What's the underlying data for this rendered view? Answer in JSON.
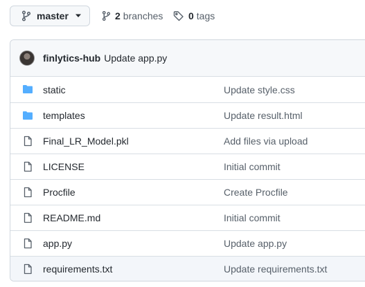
{
  "toolbar": {
    "branch_name": "master",
    "branches_count": "2",
    "branches_label": "branches",
    "tags_count": "0",
    "tags_label": "tags"
  },
  "commit": {
    "author": "finlytics-hub",
    "message": "Update app.py"
  },
  "files": [
    {
      "type": "folder",
      "name": "static",
      "commit": "Update style.css"
    },
    {
      "type": "folder",
      "name": "templates",
      "commit": "Update result.html"
    },
    {
      "type": "file",
      "name": "Final_LR_Model.pkl",
      "commit": "Add files via upload"
    },
    {
      "type": "file",
      "name": "LICENSE",
      "commit": "Initial commit"
    },
    {
      "type": "file",
      "name": "Procfile",
      "commit": "Create Procfile"
    },
    {
      "type": "file",
      "name": "README.md",
      "commit": "Initial commit"
    },
    {
      "type": "file",
      "name": "app.py",
      "commit": "Update app.py"
    },
    {
      "type": "file",
      "name": "requirements.txt",
      "commit": "Update requirements.txt"
    }
  ],
  "colors": {
    "folder": "#54aeff",
    "file_icon": "#57606a",
    "border": "#d0d7de",
    "header_bg": "#f6f8fa"
  }
}
